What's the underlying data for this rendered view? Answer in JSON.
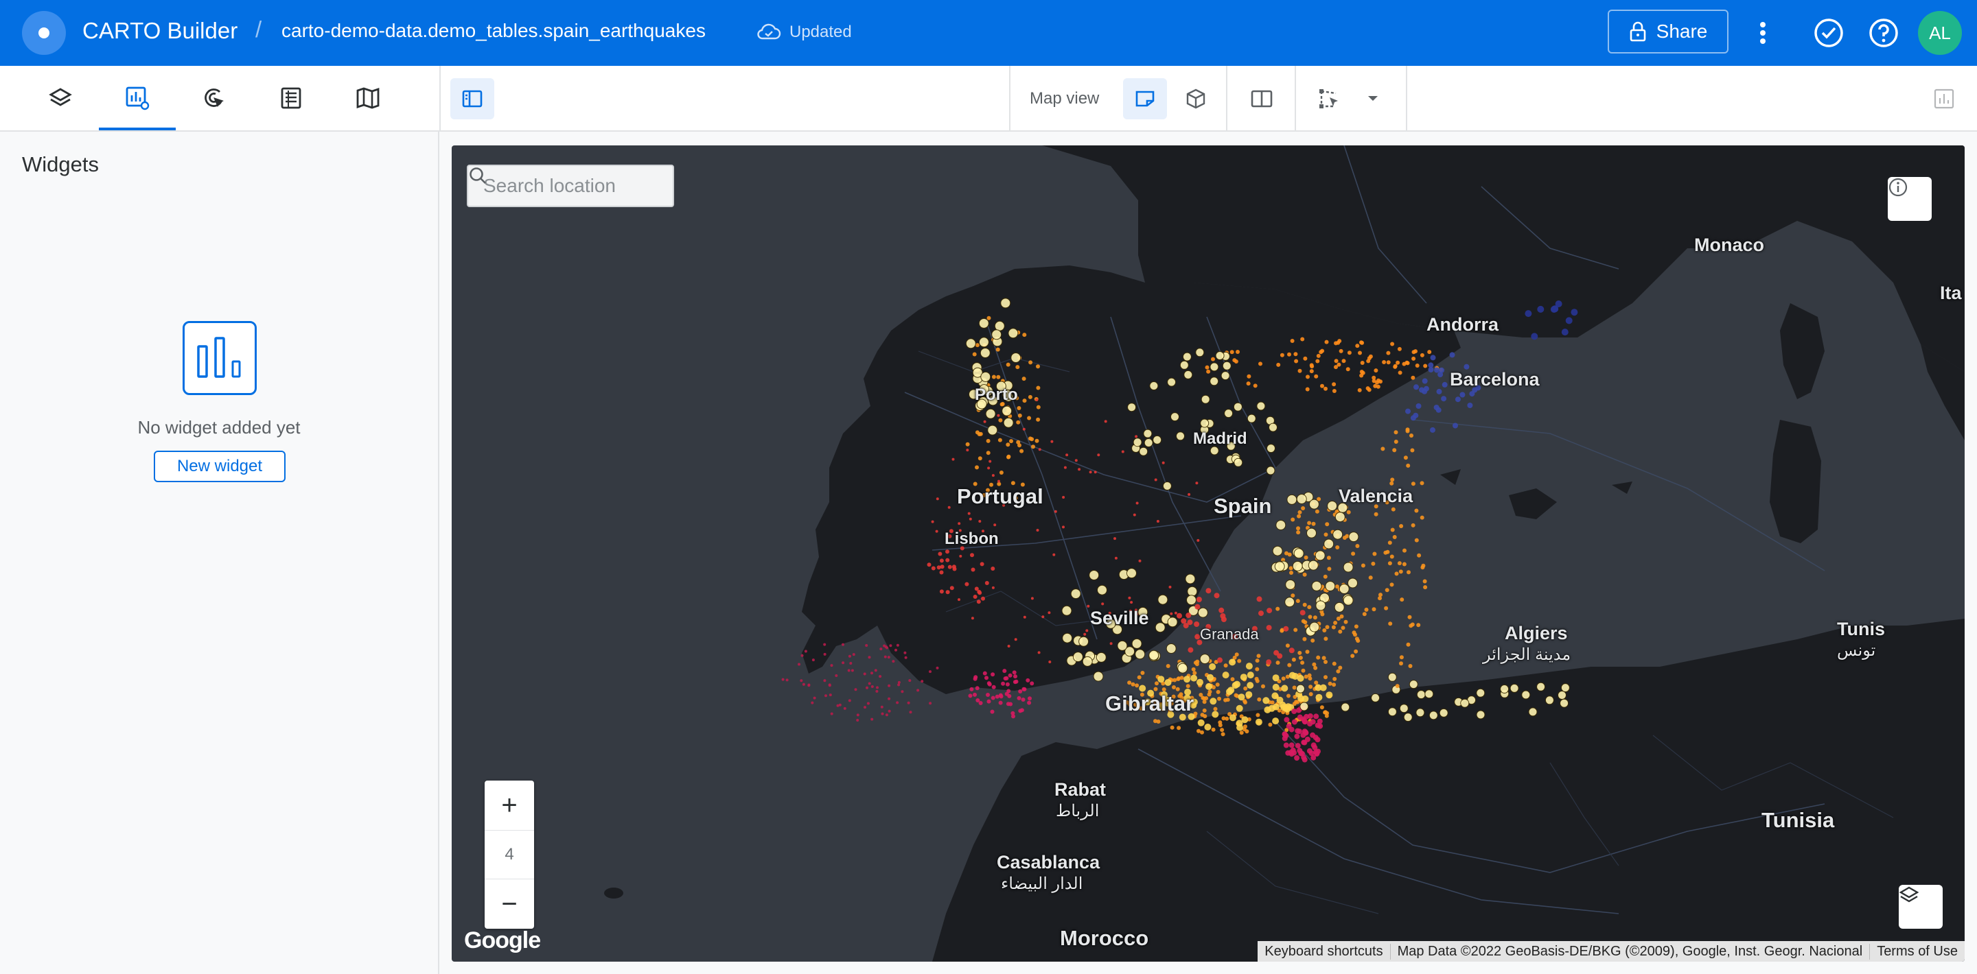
{
  "header": {
    "app_name": "CARTO Builder",
    "separator": "/",
    "dataset": "carto-demo-data.demo_tables.spain_earthquakes",
    "status": "Updated",
    "share_label": "Share",
    "avatar_initials": "AL",
    "accent_color": "#036fe2"
  },
  "toolbar": {
    "tabs": [
      {
        "icon": "layers-icon"
      },
      {
        "icon": "widgets-icon",
        "active": true
      },
      {
        "icon": "interactions-icon"
      },
      {
        "icon": "sql-icon"
      },
      {
        "icon": "basemap-icon"
      }
    ],
    "map_view_label": "Map view"
  },
  "panel": {
    "title": "Widgets",
    "empty_text": "No widget added yet",
    "new_widget_label": "New widget"
  },
  "map": {
    "search_placeholder": "Search location",
    "zoom_level": "4",
    "zoom_in": "+",
    "zoom_out": "−",
    "google": "Google",
    "attribution": {
      "shortcuts": "Keyboard shortcuts",
      "data": "Map Data ©2022 GeoBasis-DE/BKG (©2009), Google, Inst. Geogr. Nacional",
      "terms": "Terms of Use"
    },
    "labels": {
      "monaco": "Monaco",
      "andorra": "Andorra",
      "barcelona": "Barcelona",
      "porto": "Porto",
      "madrid": "Madrid",
      "portugal": "Portugal",
      "spain": "Spain",
      "valencia": "Valencia",
      "lisbon": "Lisbon",
      "seville": "Seville",
      "granada": "Granada",
      "gibraltar": "Gibraltar",
      "algiers": "Algiers",
      "algiers_ar": "مدينة الجزائر",
      "tunis": "Tunis",
      "tunis_ar": "تونس",
      "rabat": "Rabat",
      "rabat_ar": "الرباط",
      "casablanca": "Casablanca",
      "casablanca_ar": "الدار البيضاء",
      "tunisia": "Tunisia",
      "morocco": "Morocco",
      "italy_partial": "Ita"
    }
  }
}
